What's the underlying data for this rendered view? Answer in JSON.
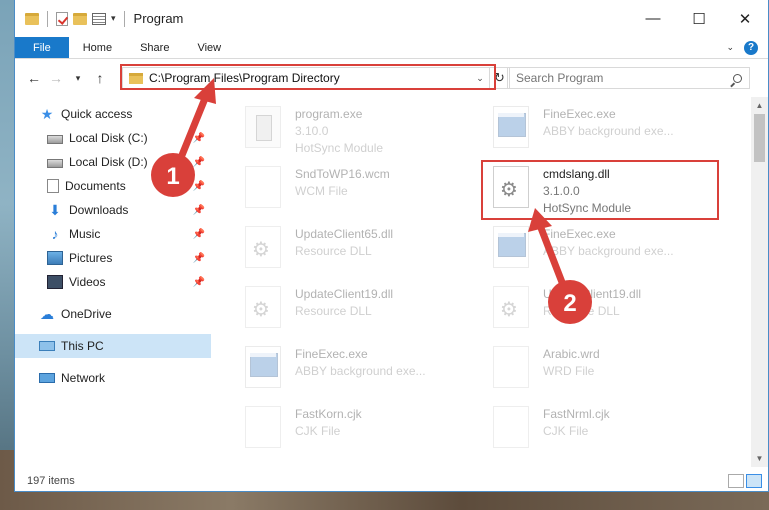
{
  "window": {
    "title": "Program",
    "controls": {
      "minimize": "—",
      "maximize": "☐",
      "close": "✕"
    }
  },
  "ribbon": {
    "tabs": [
      "File",
      "Home",
      "Share",
      "View"
    ]
  },
  "address": {
    "path": "C:\\Program Files\\Program Directory",
    "search_placeholder": "Search Program"
  },
  "nav": {
    "items": [
      {
        "label": "Quick access",
        "icon": "star-icon",
        "pinned": false
      },
      {
        "label": "Local Disk (C:)",
        "icon": "drive-icon",
        "pinned": true
      },
      {
        "label": "Local Disk (D:)",
        "icon": "drive-icon",
        "pinned": true
      },
      {
        "label": "Documents",
        "icon": "document-icon",
        "pinned": true
      },
      {
        "label": "Downloads",
        "icon": "download-icon",
        "pinned": true
      },
      {
        "label": "Music",
        "icon": "music-icon",
        "pinned": true
      },
      {
        "label": "Pictures",
        "icon": "pictures-icon",
        "pinned": true
      },
      {
        "label": "Videos",
        "icon": "videos-icon",
        "pinned": true
      },
      {
        "label": "OneDrive",
        "icon": "cloud-icon",
        "pinned": false
      },
      {
        "label": "This PC",
        "icon": "computer-icon",
        "pinned": false,
        "selected": true
      },
      {
        "label": "Network",
        "icon": "network-icon",
        "pinned": false
      }
    ]
  },
  "files": [
    {
      "name": "program.exe",
      "line2": "3.10.0",
      "line3": "HotSync Module",
      "type": "pda"
    },
    {
      "name": "FineExec.exe",
      "line2": "ABBY background exe...",
      "line3": "",
      "type": "exe"
    },
    {
      "name": "SndToWP16.wcm",
      "line2": "WCM File",
      "line3": "",
      "type": "blank"
    },
    {
      "name": "cmdslang.dll",
      "line2": "3.1.0.0",
      "line3": "HotSync Module",
      "type": "gear",
      "highlight": true
    },
    {
      "name": "UpdateClient65.dll",
      "line2": "Resource DLL",
      "line3": "",
      "type": "gear"
    },
    {
      "name": "FineExec.exe",
      "line2": "ABBY background exe...",
      "line3": "",
      "type": "exe"
    },
    {
      "name": "UpdateClient19.dll",
      "line2": "Resource DLL",
      "line3": "",
      "type": "gear"
    },
    {
      "name": "UpdateClient19.dll",
      "line2": "Resource DLL",
      "line3": "",
      "type": "gear"
    },
    {
      "name": "FineExec.exe",
      "line2": "ABBY background exe...",
      "line3": "",
      "type": "exe"
    },
    {
      "name": "Arabic.wrd",
      "line2": "WRD File",
      "line3": "",
      "type": "blank"
    },
    {
      "name": "FastKorn.cjk",
      "line2": "CJK File",
      "line3": "",
      "type": "blank"
    },
    {
      "name": "FastNrml.cjk",
      "line2": "CJK File",
      "line3": "",
      "type": "blank"
    }
  ],
  "status": {
    "count": "197 items"
  },
  "annotations": {
    "step1": "1",
    "step2": "2",
    "color": "#d9403a"
  }
}
